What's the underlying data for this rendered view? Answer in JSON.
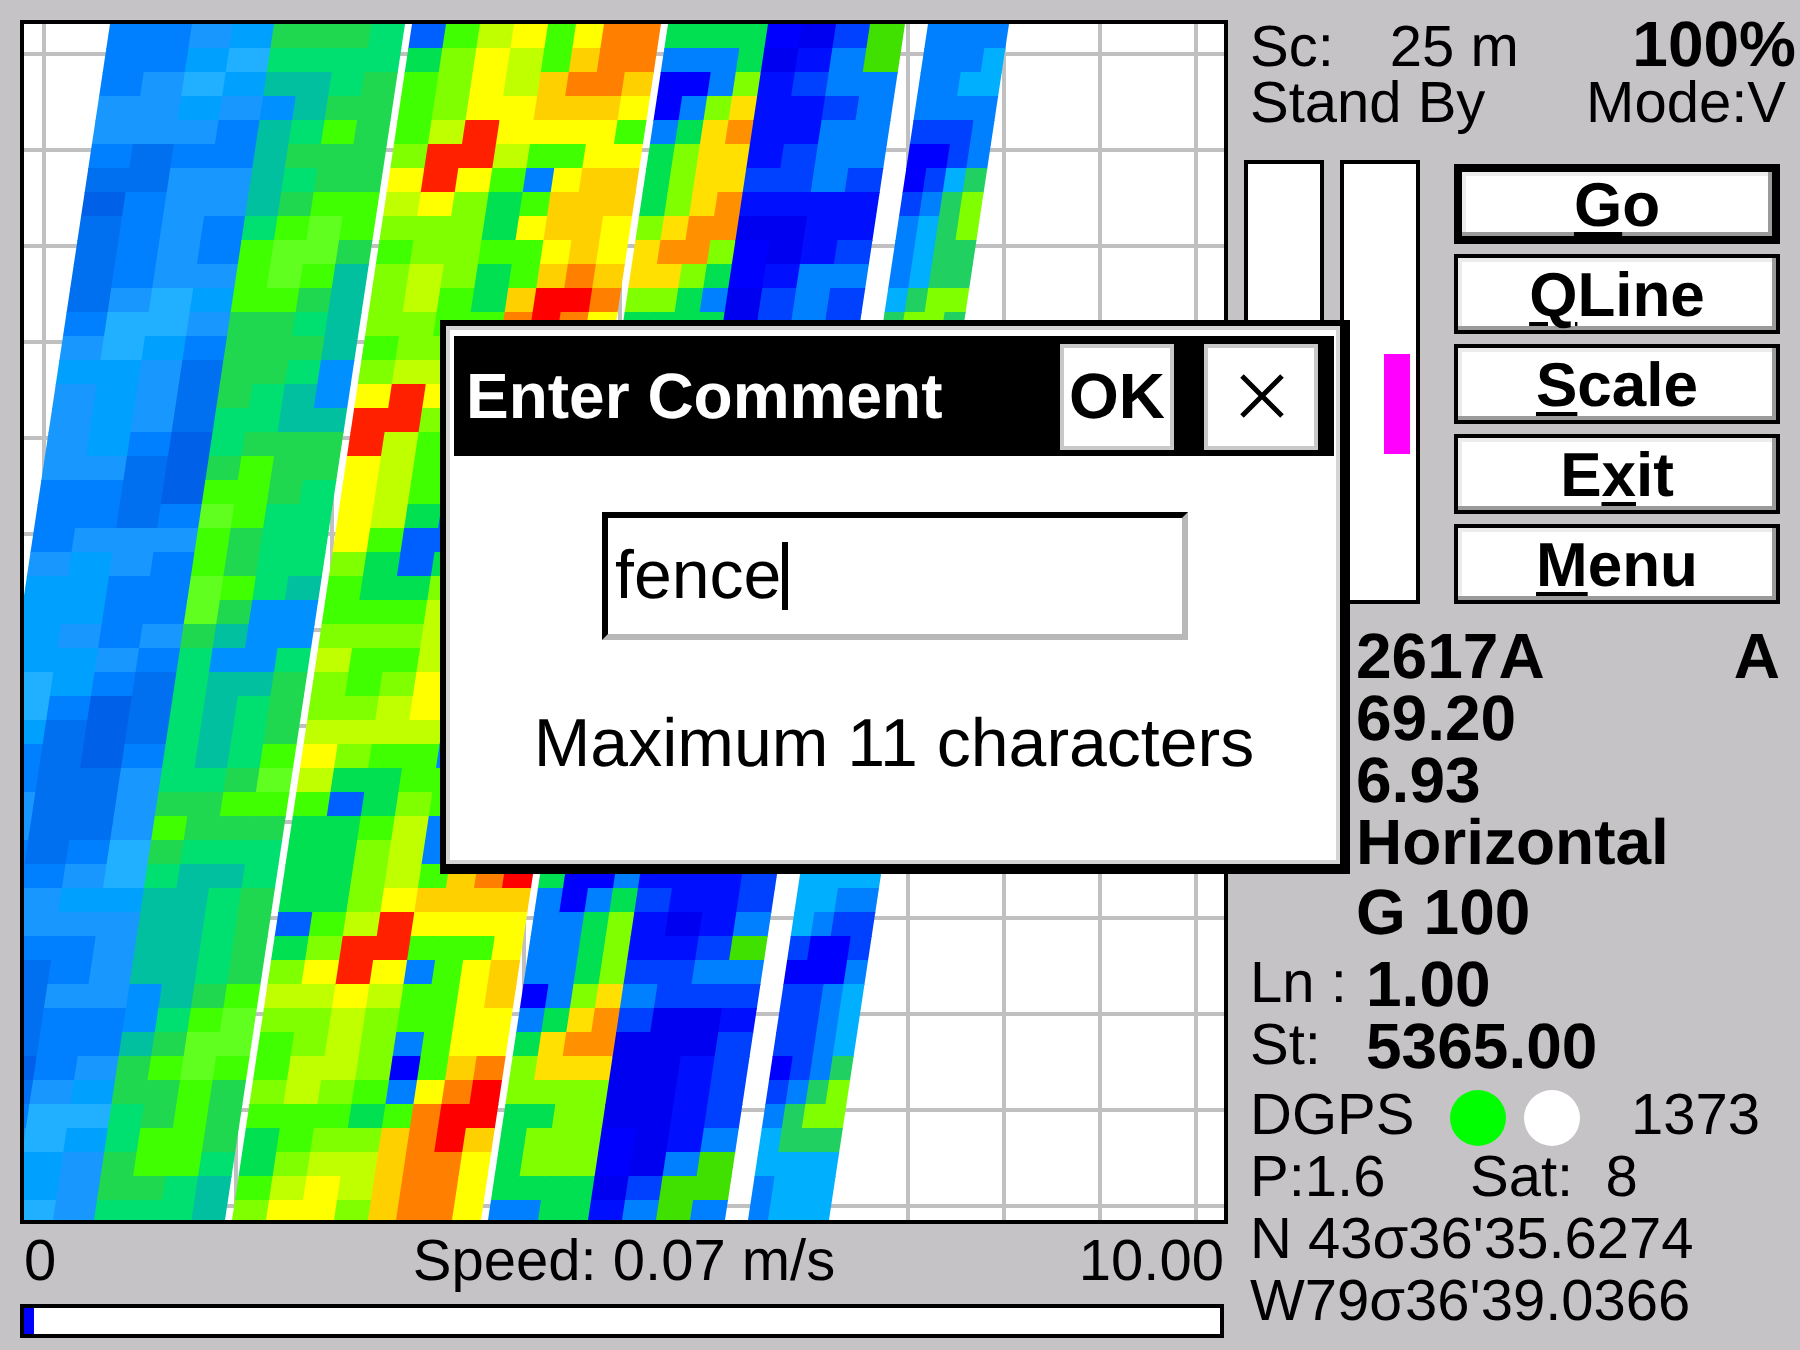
{
  "status": {
    "scale_label": "Sc:",
    "scale_value": "25 m",
    "percent": "100%",
    "state": "Stand By",
    "mode": "Mode:V"
  },
  "gauges": [
    {
      "marker": false
    },
    {
      "marker": true,
      "level": 0.45
    }
  ],
  "buttons": [
    {
      "key": "G",
      "post": "o",
      "default": true
    },
    {
      "key": "Q",
      "post": "Line",
      "default": false
    },
    {
      "key": "S",
      "post": "cale",
      "default": false
    },
    {
      "pre": "E",
      "key": "x",
      "post": "it",
      "default": false
    },
    {
      "key": "M",
      "post": "enu",
      "default": false
    }
  ],
  "readouts": [
    "2617A",
    "69.20",
    "6.93",
    "Horizontal"
  ],
  "flag": "A",
  "setting": "G 100",
  "line": {
    "label": "Ln :",
    "value": "1.00"
  },
  "station": {
    "label": "St:",
    "value": "5365.00"
  },
  "gps": {
    "label": "DGPS",
    "indicators": [
      {
        "color": "#00ff00"
      },
      {
        "color": "#ffffff"
      }
    ],
    "number": "1373",
    "p": "P:1.6",
    "sat": "Sat:  8",
    "latitude": "N 43σ36'35.6274",
    "longitude": "W79σ36'39.0366"
  },
  "speed_bar": {
    "min": "0",
    "label": "Speed: 0.07 m/s",
    "max": "10.00",
    "level": 0.008
  },
  "dialog": {
    "title": "Enter Comment",
    "ok": "OK",
    "field": {
      "value": "fence",
      "focused": true
    },
    "hint": "Maximum 11 characters"
  }
}
